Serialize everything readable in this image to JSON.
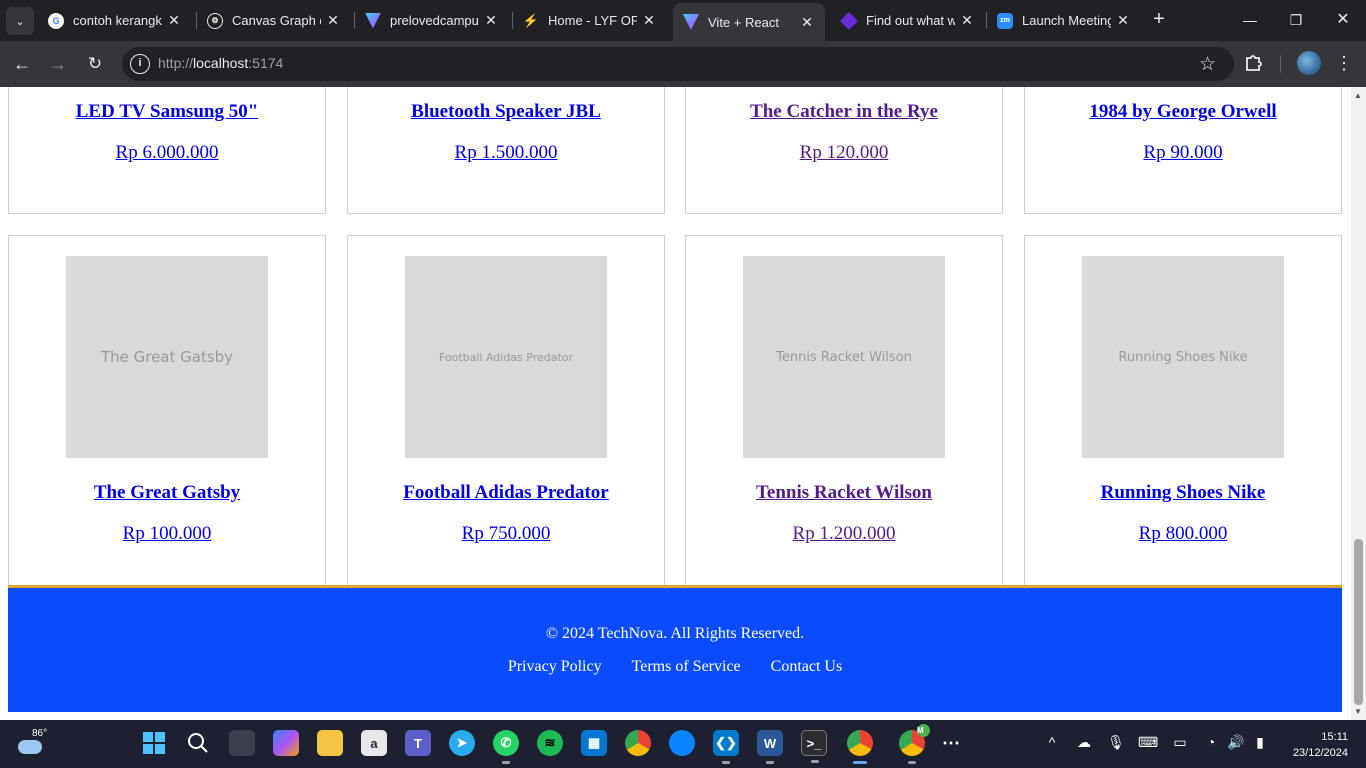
{
  "browser": {
    "tabs": [
      {
        "title": "contoh kerangka",
        "favicon": "google-icon"
      },
      {
        "title": "Canvas Graph d",
        "favicon": "openai-icon"
      },
      {
        "title": "prelovedcampu",
        "favicon": "vite-icon"
      },
      {
        "title": "Home - LYF OFF",
        "favicon": "lyf-icon"
      },
      {
        "title": "Vite + React",
        "favicon": "vite-icon",
        "active": true
      },
      {
        "title": "Find out what w",
        "favicon": "diamond-icon"
      },
      {
        "title": "Launch Meeting",
        "favicon": "zoom-icon"
      }
    ],
    "address": {
      "scheme": "http://",
      "host": "localhost",
      "port": ":5174"
    },
    "zoom_favicon_text": "zm"
  },
  "products_row1": [
    {
      "name": "LED TV Samsung 50\"",
      "price": "Rp 6.000.000",
      "visited": false
    },
    {
      "name": "Bluetooth Speaker JBL",
      "price": "Rp 1.500.000",
      "visited": false
    },
    {
      "name": "The Catcher in the Rye",
      "price": "Rp 120.000",
      "visited": true
    },
    {
      "name": "1984 by George Orwell",
      "price": "Rp 90.000",
      "visited": false
    }
  ],
  "products_row2": [
    {
      "name": "The Great Gatsby",
      "price": "Rp 100.000",
      "image_text": "The Great Gatsby",
      "visited": false
    },
    {
      "name": "Football Adidas Predator",
      "price": "Rp 750.000",
      "image_text": "Football Adidas Predator",
      "visited": false
    },
    {
      "name": "Tennis Racket Wilson",
      "price": "Rp 1.200.000",
      "image_text": "Tennis Racket Wilson",
      "visited": true
    },
    {
      "name": "Running Shoes Nike",
      "price": "Rp 800.000",
      "image_text": "Running Shoes Nike",
      "visited": false
    }
  ],
  "footer": {
    "copyright": "© 2024 TechNova. All Rights Reserved.",
    "links": [
      "Privacy Policy",
      "Terms of Service",
      "Contact Us"
    ],
    "background": "#0a4bff",
    "accent": "#e0a526"
  },
  "taskbar": {
    "weather_temp": "86°",
    "badge": "M",
    "time": "15:11",
    "date": "23/12/2024"
  }
}
